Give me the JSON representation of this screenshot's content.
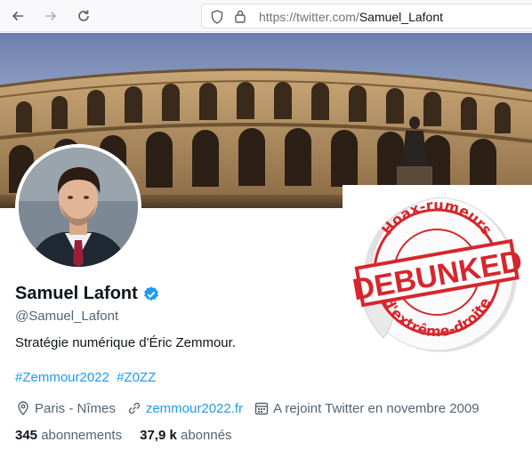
{
  "browser": {
    "url_prefix": "https://twitter.com/",
    "url_path": "Samuel_Lafont",
    "icons": [
      "arrow-left-icon",
      "arrow-right-icon",
      "reload-icon",
      "shield-icon",
      "lock-icon"
    ]
  },
  "profile": {
    "name": "Samuel Lafont",
    "handle": "@Samuel_Lafont",
    "bio": "Stratégie numérique d'Éric Zemmour.",
    "hashtags": [
      "#Zemmour2022",
      "#Z0ZZ"
    ],
    "location": "Paris - Nîmes",
    "website": "zemmour2022.fr",
    "joined": "A rejoint Twitter en novembre 2009",
    "following_count": "345",
    "following_label": "abonnements",
    "followers_count": "37,9 k",
    "followers_label": "abonnés"
  },
  "sticker": {
    "top_text": "Hoax-rumeurs",
    "main_text": "DEBUNKED",
    "bottom_text": "d'extrême-droite"
  },
  "colors": {
    "link": "#1d9bf0",
    "secondary_text": "#536471",
    "stamp_red": "#d6262d"
  }
}
